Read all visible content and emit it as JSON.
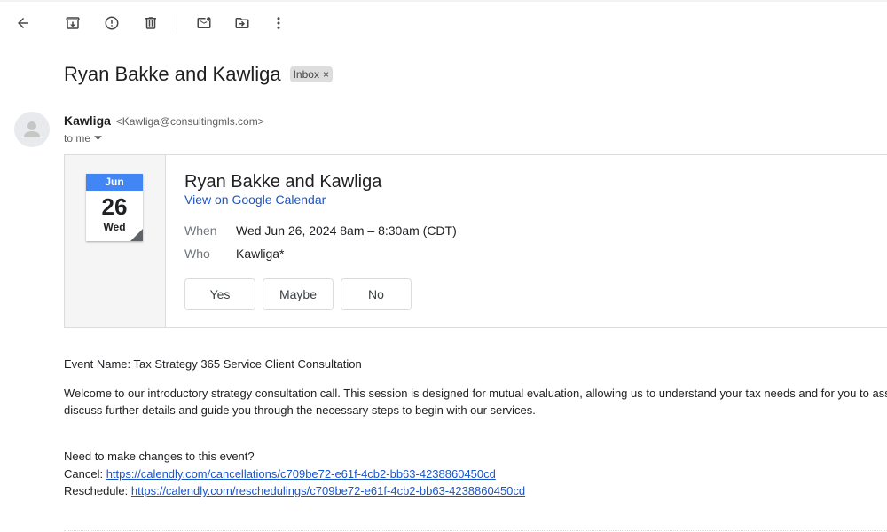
{
  "toolbar": {
    "icons": [
      "back-arrow-icon",
      "archive-icon",
      "report-spam-icon",
      "delete-icon",
      "mark-unread-icon",
      "move-to-icon",
      "more-vert-icon"
    ]
  },
  "email": {
    "subject": "Ryan Bakke and Kawliga",
    "label": "Inbox",
    "label_close": "×",
    "sender_name": "Kawliga",
    "sender_email": "<Kawliga@consultingmls.com>",
    "recipient": "to me"
  },
  "invite": {
    "month": "Jun",
    "day": "26",
    "weekday": "Wed",
    "title": "Ryan Bakke and Kawliga",
    "calendar_link": "View on Google Calendar",
    "when_label": "When",
    "when_value": "Wed Jun 26, 2024 8am – 8:30am (CDT)",
    "who_label": "Who",
    "who_value": "Kawliga*",
    "yes": "Yes",
    "maybe": "Maybe",
    "no": "No"
  },
  "body": {
    "event_name": "Event Name: Tax Strategy 365 Service Client Consultation",
    "welcome_line1": "Welcome to our introductory strategy consultation call. This session is designed for mutual evaluation, allowing us to understand your tax needs and for you to ass",
    "welcome_line2": "discuss further details and guide you through the necessary steps to begin with our services.",
    "changes": "Need to make changes to this event?",
    "cancel_label": "Cancel:",
    "cancel_url": "https://calendly.com/cancellations/c709be72-e61f-4cb2-bb63-4238860450cd",
    "reschedule_label": "Reschedule:",
    "reschedule_url": "https://calendly.com/reschedulings/c709be72-e61f-4cb2-bb63-4238860450cd"
  },
  "colors": {
    "link": "#1a55c8",
    "calendar_blue": "#4285f4"
  }
}
